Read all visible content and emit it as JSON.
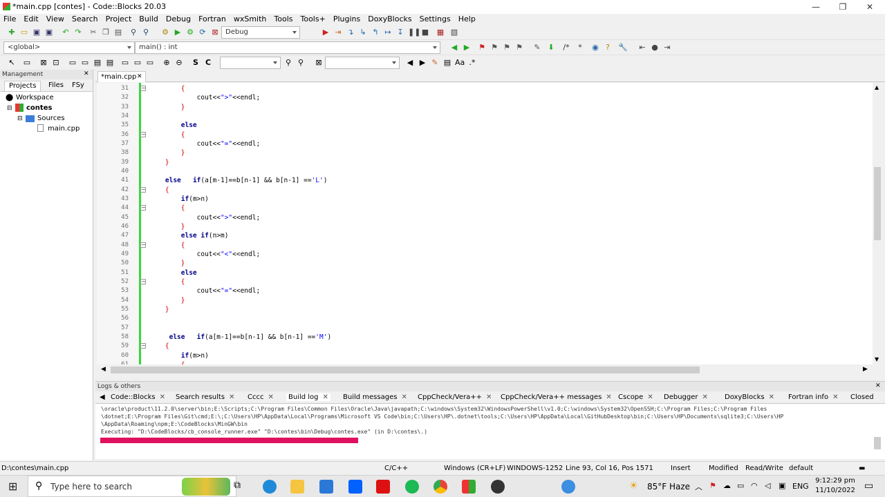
{
  "window": {
    "title": "*main.cpp [contes] - Code::Blocks 20.03",
    "minimize": "—",
    "maximize": "❐",
    "close": "✕"
  },
  "menu": [
    "File",
    "Edit",
    "View",
    "Search",
    "Project",
    "Build",
    "Debug",
    "Fortran",
    "wxSmith",
    "Tools",
    "Tools+",
    "Plugins",
    "DoxyBlocks",
    "Settings",
    "Help"
  ],
  "toolbar": {
    "build_target": "Debug",
    "scope": "<global>",
    "function": "main() : int",
    "search_a": "",
    "search_b": ""
  },
  "management": {
    "title": "Management",
    "tabs": [
      "Projects",
      "Files",
      "FSy"
    ],
    "workspace": "Workspace",
    "project": "contes",
    "folder": "Sources",
    "file": "main.cpp"
  },
  "editor": {
    "tab": "*main.cpp",
    "close": "✕",
    "lines": [
      {
        "n": "31",
        "t": "        {"
      },
      {
        "n": "32",
        "t": "            cout<<\">\"<<endl;"
      },
      {
        "n": "33",
        "t": "        }"
      },
      {
        "n": "34",
        "t": ""
      },
      {
        "n": "35",
        "t": "        else"
      },
      {
        "n": "36",
        "t": "        {"
      },
      {
        "n": "37",
        "t": "            cout<<\"=\"<<endl;"
      },
      {
        "n": "38",
        "t": "        }"
      },
      {
        "n": "39",
        "t": "    }"
      },
      {
        "n": "40",
        "t": ""
      },
      {
        "n": "41",
        "t": "    else   if(a[m-1]==b[n-1] && b[n-1] =='L')"
      },
      {
        "n": "42",
        "t": "    {"
      },
      {
        "n": "43",
        "t": "        if(m>n)"
      },
      {
        "n": "44",
        "t": "        {"
      },
      {
        "n": "45",
        "t": "            cout<<\">\"<<endl;"
      },
      {
        "n": "46",
        "t": "        }"
      },
      {
        "n": "47",
        "t": "        else if(n>m)"
      },
      {
        "n": "48",
        "t": "        {"
      },
      {
        "n": "49",
        "t": "            cout<<\"<\"<<endl;"
      },
      {
        "n": "50",
        "t": "        }"
      },
      {
        "n": "51",
        "t": "        else"
      },
      {
        "n": "52",
        "t": "        {"
      },
      {
        "n": "53",
        "t": "            cout<<\"=\"<<endl;"
      },
      {
        "n": "54",
        "t": "        }"
      },
      {
        "n": "55",
        "t": "    }"
      },
      {
        "n": "56",
        "t": ""
      },
      {
        "n": "57",
        "t": ""
      },
      {
        "n": "58",
        "t": "     else   if(a[m-1]==b[n-1] && b[n-1] =='M')"
      },
      {
        "n": "59",
        "t": "    {"
      },
      {
        "n": "60",
        "t": "        if(m>n)"
      },
      {
        "n": "61",
        "t": "        {"
      }
    ]
  },
  "logs": {
    "title": "Logs & others",
    "close": "✕",
    "tabs": [
      "Code::Blocks",
      "Search results",
      "Cccc",
      "Build log",
      "Build messages",
      "CppCheck/Vera++",
      "CppCheck/Vera++ messages",
      "Cscope",
      "Debugger",
      "DoxyBlocks",
      "Fortran info",
      "Closed"
    ],
    "lines": [
      "\\oracle\\product\\11.2.0\\server\\bin;E:\\Scripts;C:\\Program Files\\Common Files\\Oracle\\Java\\javapath;C:\\windows\\System32\\WindowsPowerShell\\v1.0;C:\\windows\\System32\\OpenSSH;C:\\Program Files;C:\\Program Files",
      "\\dotnet;E:\\Program Files\\Git\\cmd;E:\\;C:\\Users\\HP\\AppData\\Local\\Programs\\Microsoft VS Code\\bin;C:\\Users\\HP\\.dotnet\\tools;C:\\Users\\HP\\AppData\\Local\\GitHubDesktop\\bin;C:\\Users\\HP\\Documents\\sqlite3;C:\\Users\\HP",
      "\\AppData\\Roaming\\npm;E:\\CodeBlocks\\MinGW\\bin",
      "Executing: \"D:\\CodeBlocks/cb_console_runner.exe\" \"D:\\contes\\bin\\Debug\\contes.exe\"  (in D:\\contes\\.)"
    ]
  },
  "status": {
    "path": "D:\\contes\\main.cpp",
    "lang": "C/C++",
    "eol": "Windows (CR+LF)",
    "enc": "WINDOWS-1252",
    "pos": "Line 93, Col 16, Pos 1571",
    "mode": "Insert",
    "modified": "Modified",
    "rw": "Read/Write",
    "profile": "default"
  },
  "taskbar": {
    "search": "Type here to search",
    "weather": "85°F Haze",
    "lang": "ENG",
    "time": "9:12:29 pm",
    "date": "11/10/2022"
  },
  "colors": {
    "accent": "#35d935",
    "progress": "#e0115f",
    "keyword": "#00008b",
    "operator": "#cc0000"
  }
}
